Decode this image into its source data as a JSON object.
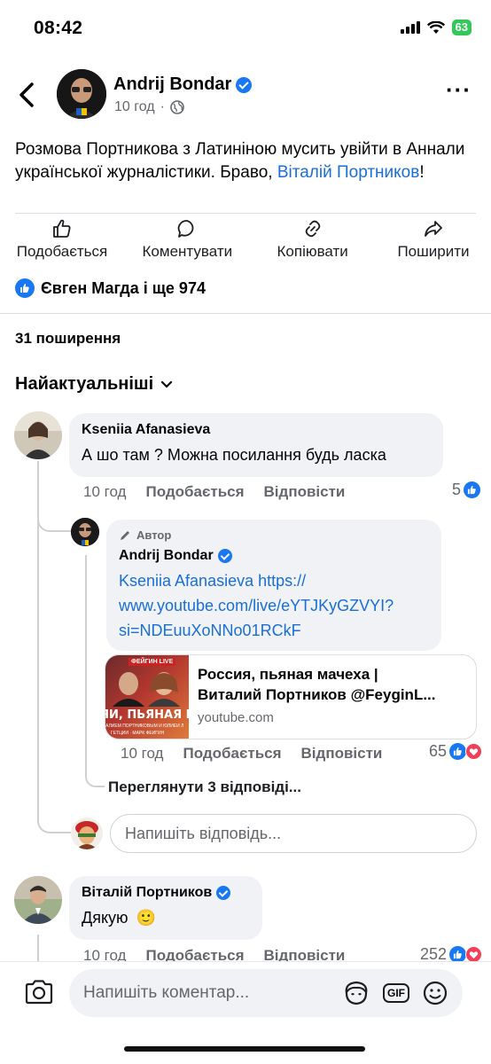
{
  "status_bar": {
    "time": "08:42",
    "battery": "63"
  },
  "post": {
    "author": "Andrij Bondar",
    "time": "10 год",
    "separator": "·",
    "text_before": "Розмова Портникова з Латиніною мусить увійти в Аннали української журналістики. Браво, ",
    "mention": "Віталій Портников",
    "text_after": "!"
  },
  "actions": {
    "like": "Подобається",
    "comment": "Коментувати",
    "copy": "Копіювати",
    "share": "Поширити"
  },
  "reactions_summary": "Євген Магда і ще 974",
  "shares_count": "31 поширення",
  "sort_label": "Найактуальніші",
  "comments": [
    {
      "author": "Kseniia  Afanasieva",
      "text": "А шо там ? Можна посилання будь ласка",
      "time": "10 год",
      "like": "Подобається",
      "reply": "Відповісти",
      "reaction_count": "5"
    },
    {
      "author": "Віталій Портников",
      "text": "Дякую",
      "emoji": "🙂",
      "time": "10 год",
      "like": "Подобається",
      "reply": "Відповісти",
      "reaction_count": "252"
    }
  ],
  "reply": {
    "author_badge": "Автор",
    "author": "Andrij Bondar",
    "mention": "Kseniia  Afanasieva",
    "url": "https://www.youtube.com/live/eYTJKyGZVYI?si=NDEuuXoNNo01RCkF",
    "url_line1": "https://",
    "url_line2": "www.youtube.com/live/eYTJKyGZVYI?",
    "url_line3": "si=NDEuuXoNNo01RCkF",
    "card_title_line1": "Россия, пьяная мачеха |",
    "card_title_line2": "Виталий Портников @FeyginL...",
    "card_domain": "youtube.com",
    "thumb_top": "ФЕЙГИН LIVE",
    "thumb_main": "ЯИ, ПЬЯНАЯ МА",
    "thumb_small": "АЛИЕМ ПОРТНИКОВЫМ И ЮЛИЕЙ Л",
    "thumb_small2": "ГЕТЦИЙ · МАРК ФЕЙГИН",
    "time": "10 год",
    "like": "Подобається",
    "reply": "Відповісти",
    "reaction_count": "65"
  },
  "view_replies": "Переглянути 3 відповіді...",
  "reply_placeholder": "Напишіть відповідь...",
  "comment_placeholder": "Напишіть коментар...",
  "gif_label": "GIF",
  "colors": {
    "accent": "#1877f2",
    "link": "#1a6ed8",
    "love": "#f33e58",
    "battery": "#34c759"
  }
}
